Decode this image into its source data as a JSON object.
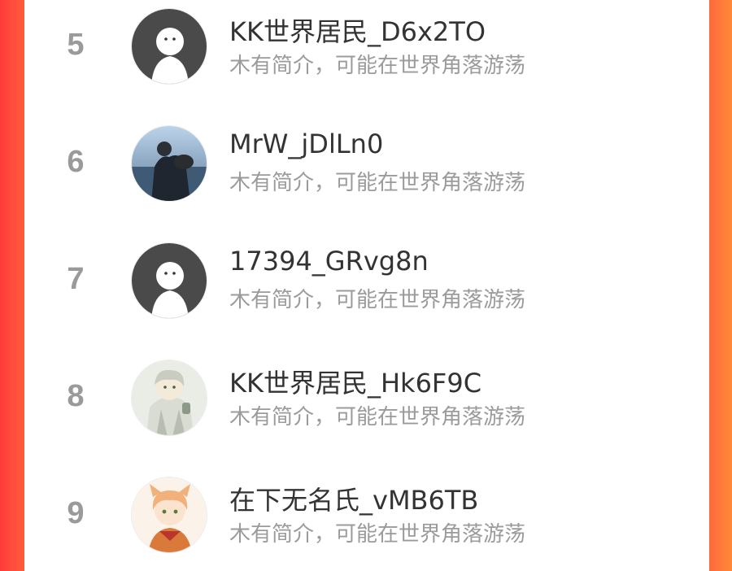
{
  "colors": {
    "accent": "#ff5a3c",
    "rank": "#9a9a9a",
    "name": "#333333",
    "bio": "#9b9b9b"
  },
  "ranking": {
    "items": [
      {
        "rank": "5",
        "name": "KK世界居民_D6x2TO",
        "bio": "木有简介，可能在世界角落游荡",
        "avatar": "default-avatar-icon"
      },
      {
        "rank": "6",
        "name": "MrW_jDlLn0",
        "bio": "木有简介，可能在世界角落游荡",
        "avatar": "photo-avatar"
      },
      {
        "rank": "7",
        "name": "17394_GRvg8n",
        "bio": "木有简介，可能在世界角落游荡",
        "avatar": "default-avatar-icon"
      },
      {
        "rank": "8",
        "name": "KK世界居民_Hk6F9C",
        "bio": "木有简介，可能在世界角落游荡",
        "avatar": "anime-avatar"
      },
      {
        "rank": "9",
        "name": "在下无名氏_vMB6TB",
        "bio": "木有简介，可能在世界角落游荡",
        "avatar": "anime-avatar"
      }
    ]
  }
}
